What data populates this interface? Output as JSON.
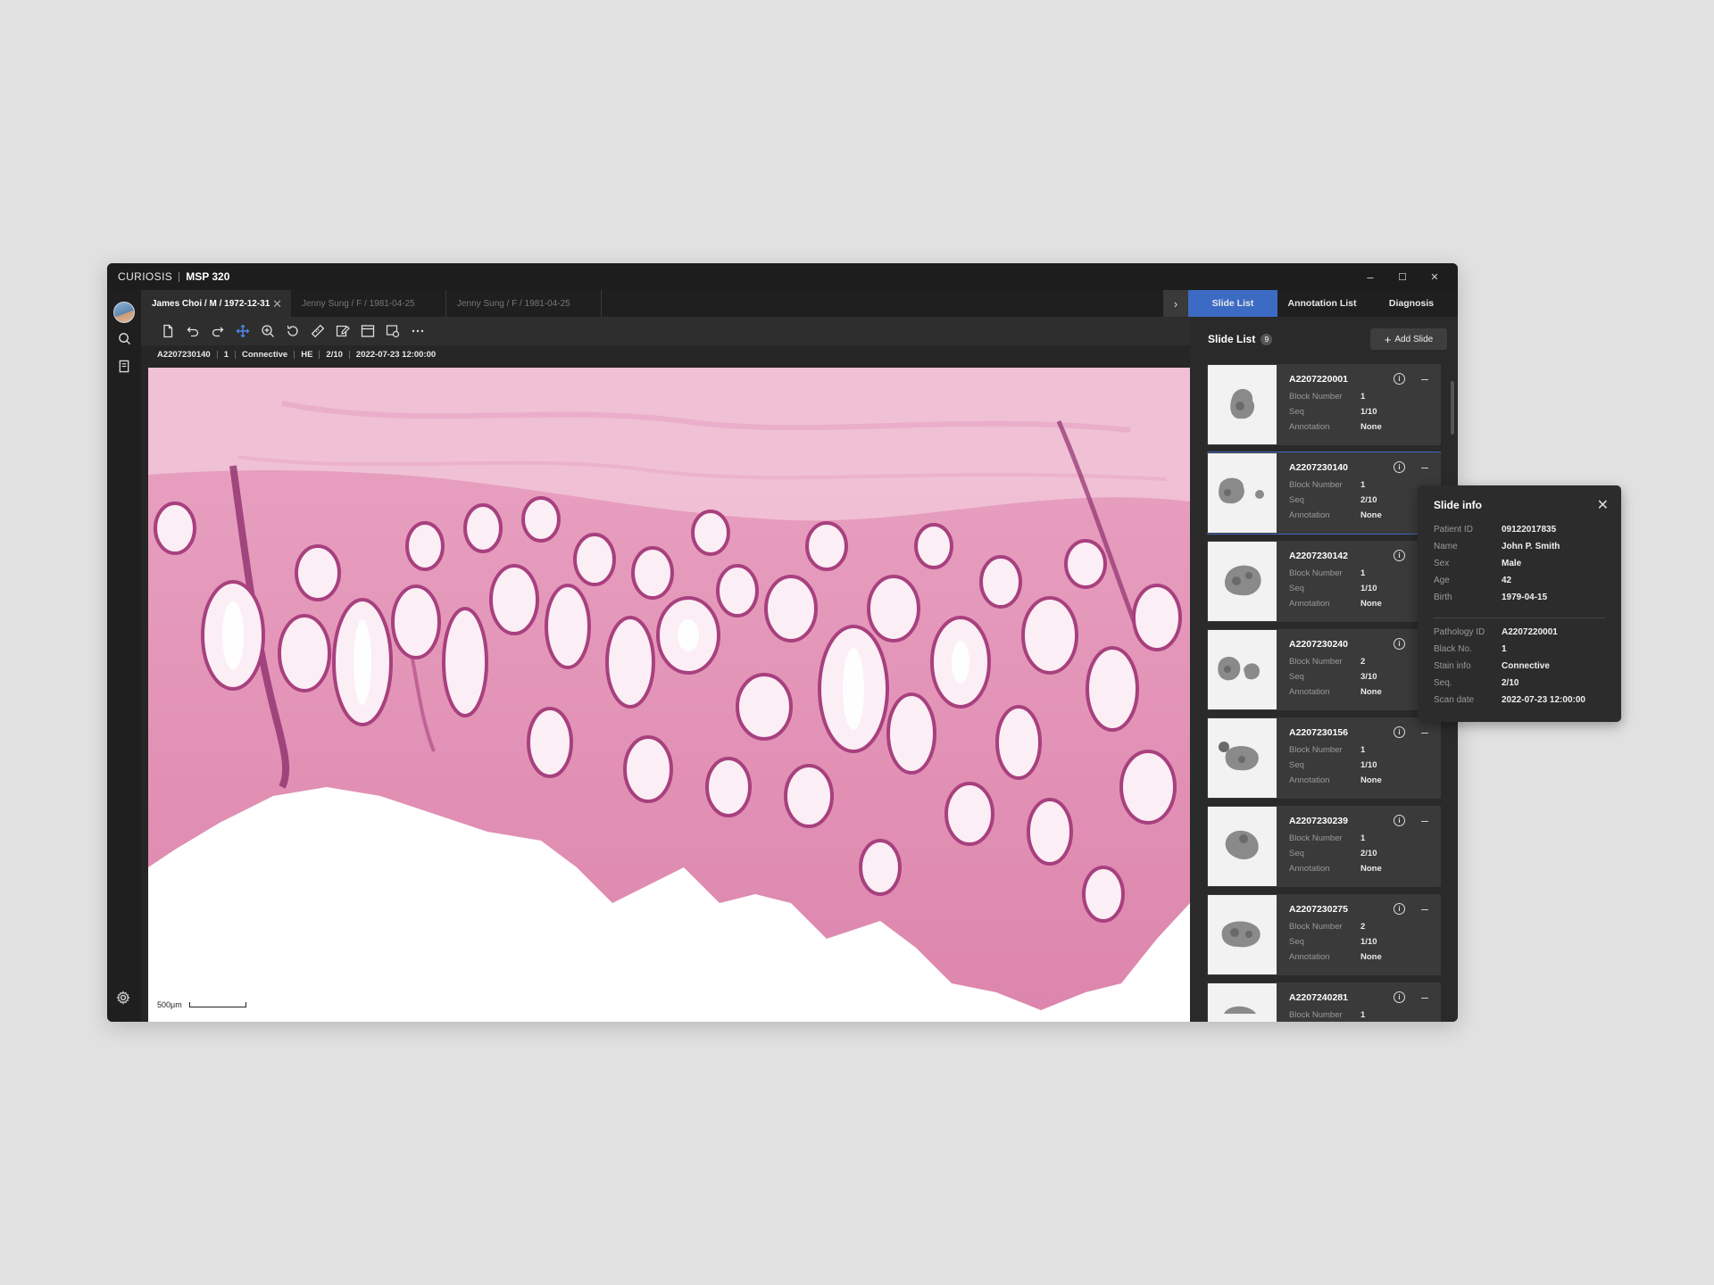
{
  "app": {
    "brand": "CURIOSIS",
    "product": "MSP 320"
  },
  "window_controls": {
    "minimize": "–",
    "maximize": "☐",
    "close": "✕"
  },
  "tabs": [
    {
      "label": "James Choi / M / 1972-12-31",
      "active": true
    },
    {
      "label": "Jenny Sung / F / 1981-04-25",
      "active": false
    },
    {
      "label": "Jenny Sung / F / 1981-04-25",
      "active": false
    }
  ],
  "panel_tabs": [
    "Slide List",
    "Annotation List",
    "Diagnosis"
  ],
  "toolbar": {
    "icons": [
      "new-file-icon",
      "undo-icon",
      "redo-icon",
      "move-icon",
      "zoom-in-icon",
      "rotate-icon",
      "ruler-icon",
      "edit-icon",
      "layout-icon",
      "capture-icon",
      "more-icon"
    ],
    "active": "move-icon"
  },
  "infobar": [
    "A2207230140",
    "1",
    "Connective",
    "HE",
    "2/10",
    "2022-07-23 12:00:00"
  ],
  "viewer": {
    "scale_label": "500μm"
  },
  "slide_panel": {
    "title": "Slide List",
    "count": "9",
    "add_label": "Add Slide",
    "labels": {
      "block": "Block Number",
      "seq": "Seq",
      "annotation": "Annotation"
    },
    "slides": [
      {
        "id": "A2207220001",
        "block": "1",
        "seq": "1/10",
        "annotation": "None"
      },
      {
        "id": "A2207230140",
        "block": "1",
        "seq": "2/10",
        "annotation": "None",
        "selected": true
      },
      {
        "id": "A2207230142",
        "block": "1",
        "seq": "1/10",
        "annotation": "None"
      },
      {
        "id": "A2207230240",
        "block": "2",
        "seq": "3/10",
        "annotation": "None"
      },
      {
        "id": "A2207230156",
        "block": "1",
        "seq": "1/10",
        "annotation": "None"
      },
      {
        "id": "A2207230239",
        "block": "1",
        "seq": "2/10",
        "annotation": "None"
      },
      {
        "id": "A2207230275",
        "block": "2",
        "seq": "1/10",
        "annotation": "None"
      },
      {
        "id": "A2207240281",
        "block": "1",
        "seq": "",
        "annotation": ""
      }
    ]
  },
  "slide_info": {
    "title": "Slide info",
    "rows": [
      {
        "label": "Patient ID",
        "value": "09122017835"
      },
      {
        "label": "Name",
        "value": "John P. Smith"
      },
      {
        "label": "Sex",
        "value": "Male"
      },
      {
        "label": "Age",
        "value": "42"
      },
      {
        "label": "Birth",
        "value": "1979-04-15"
      },
      {
        "label": "Pathology ID",
        "value": "A2207220001"
      },
      {
        "label": "Black No.",
        "value": "1"
      },
      {
        "label": "Stain info",
        "value": "Connective"
      },
      {
        "label": "Seq.",
        "value": "2/10"
      },
      {
        "label": "Scan date",
        "value": "2022-07-23 12:00:00"
      }
    ]
  },
  "colors": {
    "accent": "#3c6bc4",
    "tissue": "#d9739f",
    "tissue_dark": "#a13a7a",
    "background": "#e1e1e1"
  }
}
